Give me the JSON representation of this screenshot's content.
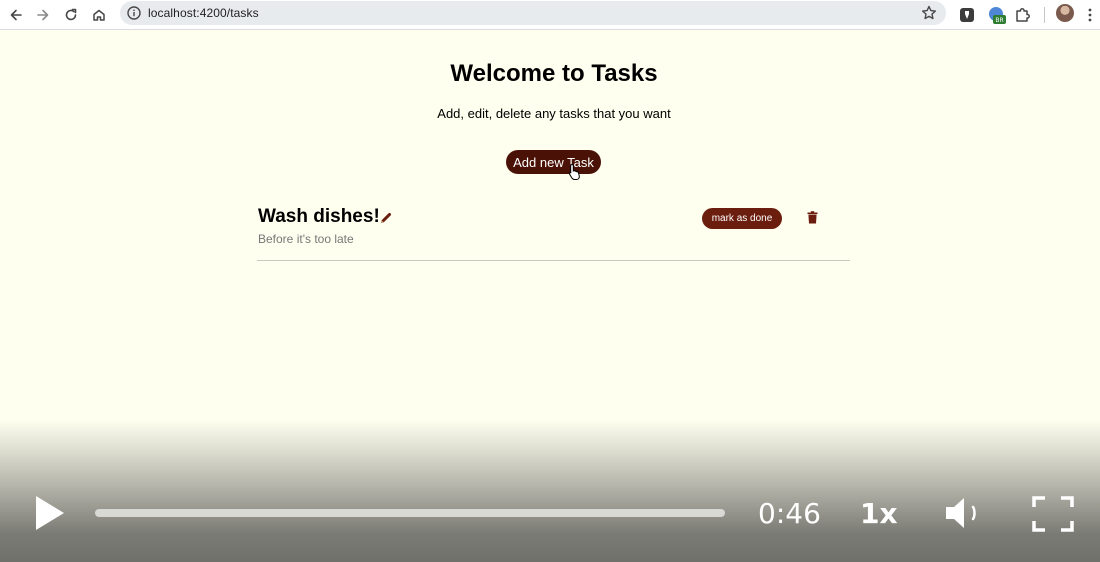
{
  "browser": {
    "url": "localhost:4200/tasks",
    "icons": {
      "back": "arrow-left-icon",
      "forward": "arrow-right-icon",
      "reload": "reload-icon",
      "home": "home-icon",
      "site_info": "info-icon",
      "bookmark": "star-icon",
      "extensions": "puzzle-icon",
      "profile": "avatar"
    },
    "extension_badge": "BR"
  },
  "page": {
    "title": "Welcome to Tasks",
    "subtitle": "Add, edit, delete any tasks that you want",
    "add_button_label": "Add new Task",
    "accent_color": "#4a1207"
  },
  "tasks": [
    {
      "title": "Wash dishes!",
      "description": "Before it's too late",
      "done_label": "mark as done"
    }
  ],
  "video": {
    "time": "0:46",
    "speed": "1x",
    "progress": 0
  }
}
